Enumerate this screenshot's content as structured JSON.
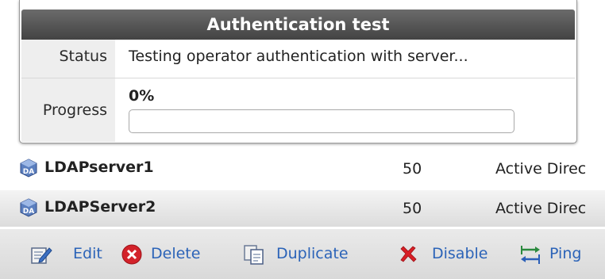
{
  "auth_test": {
    "title": "Authentication test",
    "status_label": "Status",
    "status_text": "Testing operator authentication with server...",
    "progress_label": "Progress",
    "progress_text": "0%",
    "progress_value": 0
  },
  "servers": [
    {
      "name": "LDAPserver1",
      "priority": "50",
      "type": "Active Direc"
    },
    {
      "name": "LDAPServer2",
      "priority": "50",
      "type": "Active Direc"
    }
  ],
  "toolbar": {
    "edit_label": "Edit",
    "delete_label": "Delete",
    "duplicate_label": "Duplicate",
    "disable_label": "Disable",
    "ping_label": "Ping"
  },
  "icons": {
    "server": "ldap-server-icon",
    "edit": "edit-icon",
    "delete": "delete-icon",
    "duplicate": "duplicate-icon",
    "disable": "disable-icon",
    "ping": "ping-icon"
  },
  "colors": {
    "title_bar": "#4f4f4f",
    "link": "#2b63b8",
    "delete": "#d3222a",
    "disable": "#d81f26"
  }
}
